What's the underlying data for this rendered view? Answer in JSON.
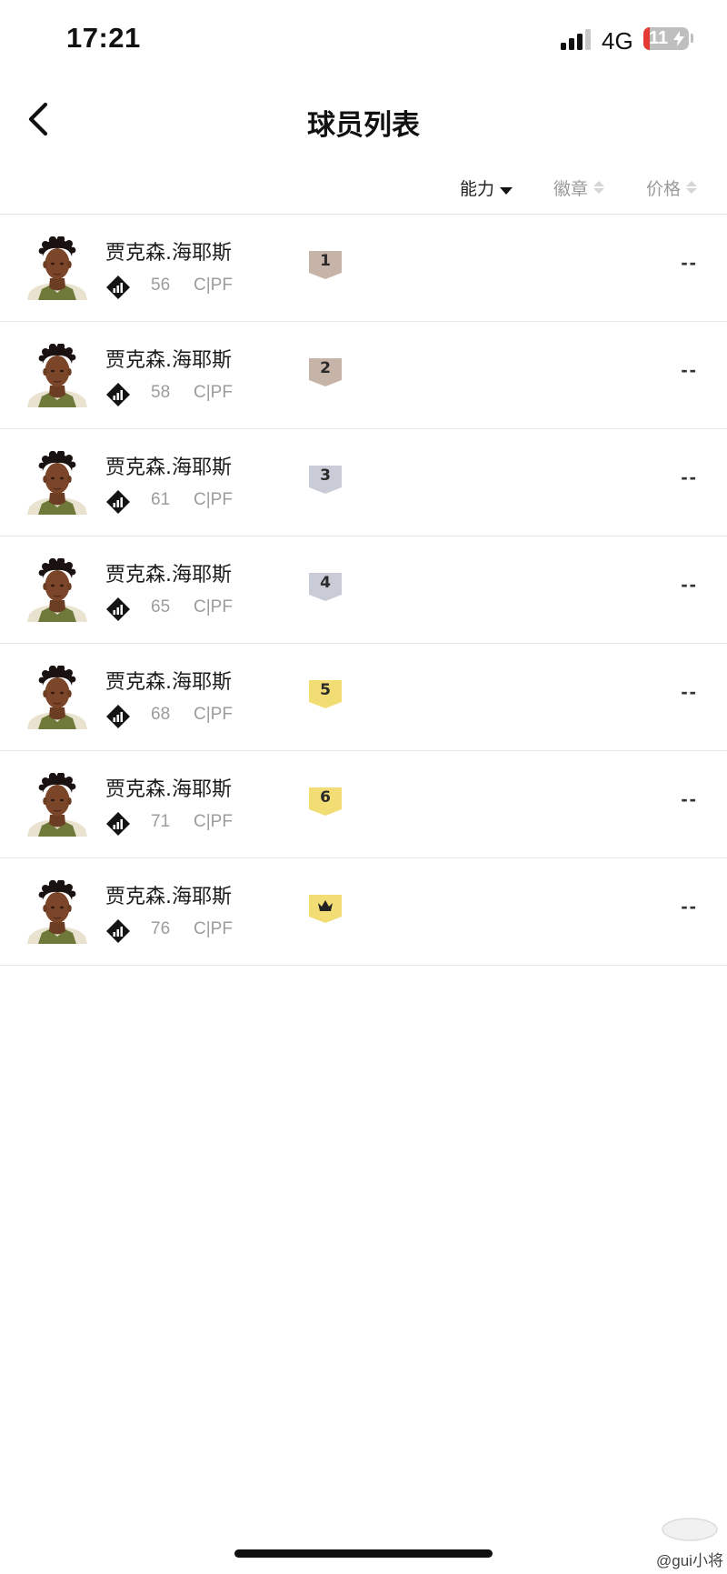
{
  "status_bar": {
    "time": "17:21",
    "network": "4G",
    "battery": "11"
  },
  "header": {
    "title": "球员列表",
    "back_icon": "chevron-left-icon"
  },
  "sort_bar": {
    "ability": "能力",
    "badge": "徽章",
    "price": "价格",
    "active": "能力",
    "active_direction": "descending"
  },
  "colors": {
    "tier_bronze": "#c7b4a8",
    "tier_silver": "#c9ccd6",
    "tier_gold": "#f2dc74",
    "divider": "#e6e6e6",
    "muted_text": "#9c9c9c"
  },
  "players": [
    {
      "name": "贾克森.海耶斯",
      "ovr": "56",
      "position": "C|PF",
      "tier": "1",
      "tier_color": "bronze",
      "price": "--"
    },
    {
      "name": "贾克森.海耶斯",
      "ovr": "58",
      "position": "C|PF",
      "tier": "2",
      "tier_color": "bronze",
      "price": "--"
    },
    {
      "name": "贾克森.海耶斯",
      "ovr": "61",
      "position": "C|PF",
      "tier": "3",
      "tier_color": "silver",
      "price": "--"
    },
    {
      "name": "贾克森.海耶斯",
      "ovr": "65",
      "position": "C|PF",
      "tier": "4",
      "tier_color": "silver",
      "price": "--"
    },
    {
      "name": "贾克森.海耶斯",
      "ovr": "68",
      "position": "C|PF",
      "tier": "5",
      "tier_color": "gold",
      "price": "--"
    },
    {
      "name": "贾克森.海耶斯",
      "ovr": "71",
      "position": "C|PF",
      "tier": "6",
      "tier_color": "gold",
      "price": "--"
    },
    {
      "name": "贾克森.海耶斯",
      "ovr": "76",
      "position": "C|PF",
      "tier": "",
      "tier_icon": "crown-icon",
      "tier_color": "gold",
      "price": "--"
    }
  ],
  "watermark": "@gui小将"
}
